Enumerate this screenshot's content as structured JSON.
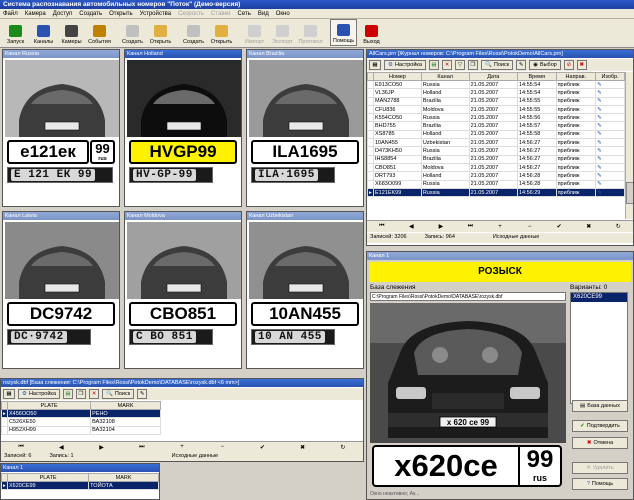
{
  "window_title": "Система распознавания автомобильных номеров \"Поток\" (Демо-версия)",
  "menu": [
    {
      "label": "Файл",
      "enabled": true
    },
    {
      "label": "Камера",
      "enabled": true
    },
    {
      "label": "Доступ",
      "enabled": true
    },
    {
      "label": "Создать",
      "enabled": true
    },
    {
      "label": "Открыть",
      "enabled": true
    },
    {
      "label": "Устройства",
      "enabled": true
    },
    {
      "label": "Скорость",
      "enabled": false
    },
    {
      "label": "Ставки",
      "enabled": false
    },
    {
      "label": "Сеть",
      "enabled": true
    },
    {
      "label": "Вид",
      "enabled": true
    },
    {
      "label": "Окно",
      "enabled": true
    }
  ],
  "toolbar": [
    {
      "label": "Запуск",
      "icon": "play-icon",
      "enabled": true
    },
    {
      "label": "Каналы",
      "icon": "channels-icon",
      "enabled": true
    },
    {
      "label": "Камеры",
      "icon": "camera-icon",
      "enabled": true
    },
    {
      "label": "События",
      "icon": "events-icon",
      "enabled": true
    },
    {
      "label": "Создать",
      "icon": "new-icon",
      "enabled": true
    },
    {
      "label": "Открыть",
      "icon": "open-icon",
      "enabled": true
    },
    {
      "label": "Создать",
      "icon": "new-icon",
      "enabled": true
    },
    {
      "label": "Открыть",
      "icon": "open-icon",
      "enabled": true
    },
    {
      "label": "Импорт",
      "icon": "import-icon",
      "enabled": false
    },
    {
      "label": "Экспорт",
      "icon": "export-icon",
      "enabled": false
    },
    {
      "label": "Протокол",
      "icon": "protocol-icon",
      "enabled": false
    },
    {
      "label": "Помощь",
      "icon": "help-icon",
      "enabled": true
    },
    {
      "label": "Выход",
      "icon": "exit-icon",
      "enabled": true
    }
  ],
  "cameras": [
    {
      "title": "Канал Russia",
      "plate": "e121ек",
      "region": "99",
      "region_sub": "rus",
      "plate_image": "Е 121 ЕК 99",
      "highlight": false
    },
    {
      "title": "Канал Holland",
      "plate": "HVGP99",
      "region": "",
      "region_sub": "",
      "plate_image": "HV-GP-99",
      "highlight": true
    },
    {
      "title": "Канал Brazilia",
      "plate": "ILA1695",
      "region": "",
      "region_sub": "",
      "plate_image": "ILA·1695",
      "highlight": false
    },
    {
      "title": "Канал Latvia",
      "plate": "DC9742",
      "region": "",
      "region_sub": "",
      "plate_image": "DC·9742",
      "highlight": false
    },
    {
      "title": "Канал Moldova",
      "plate": "CBO851",
      "region": "",
      "region_sub": "",
      "plate_image": "C BO 851",
      "highlight": false
    },
    {
      "title": "Канал Uzbekistan",
      "plate": "10AN455",
      "region": "",
      "region_sub": "",
      "plate_image": "10 AN 455",
      "highlight": false
    }
  ],
  "journal": {
    "title": "AllCars.prn [Журнал номеров: C:\\Program Files\\Rossi\\PotokDemo\\AllCars.prn]",
    "toolbar": {
      "settings": "Настройка",
      "search": "Поиск",
      "select": "Выбор"
    },
    "columns": [
      "Номер",
      "Канал",
      "Дата",
      "Время",
      "Направ.",
      "Изобр."
    ],
    "rows": [
      [
        "E913CO50",
        "Russia",
        "21.05.2007",
        "14:55:54",
        "приближ",
        ""
      ],
      [
        "VL36JP",
        "Holland",
        "21.05.2007",
        "14:55:54",
        "приближ",
        ""
      ],
      [
        "MAN2788",
        "Brazilia",
        "21.05.2007",
        "14:55:55",
        "приближ",
        ""
      ],
      [
        "CFU836",
        "Moldova",
        "21.05.2007",
        "14:55:55",
        "приближ",
        ""
      ],
      [
        "K554CO50",
        "Russia",
        "21.05.2007",
        "14:55:56",
        "приближ",
        ""
      ],
      [
        "BHD755",
        "Brazilia",
        "21.05.2007",
        "14:55:57",
        "приближ",
        ""
      ],
      [
        "XS8785",
        "Holland",
        "21.05.2007",
        "14:55:58",
        "приближ",
        ""
      ],
      [
        "10AN455",
        "Uzbekistan",
        "21.05.2007",
        "14:56:27",
        "приближ",
        ""
      ],
      [
        "D473KH50",
        "Russia",
        "21.05.2007",
        "14:56:27",
        "приближ",
        ""
      ],
      [
        "IHS8854",
        "Brazilia",
        "21.05.2007",
        "14:56:27",
        "приближ",
        ""
      ],
      [
        "CBO851",
        "Moldova",
        "21.05.2007",
        "14:56:27",
        "приближ",
        ""
      ],
      [
        "DRT793",
        "Holland",
        "21.05.2007",
        "14:56:28",
        "приближ",
        ""
      ],
      [
        "X683O099",
        "Russia",
        "21.05.2007",
        "14:56:28",
        "приближ",
        ""
      ],
      [
        "E121EK99",
        "Russia",
        "21.05.2007",
        "14:56:29",
        "приближ",
        ""
      ]
    ],
    "selected_row": 13,
    "status": {
      "records": "Записей: 3206",
      "record": "Запись: 964",
      "source": "Исходные данные"
    }
  },
  "wanted": {
    "title": "rozysk.dbf [База слежения: C:\\Program Files\\Rossi\\PotokDemo\\DATABASE\\rozysk.dbf <6 mm>]",
    "toolbar": {
      "settings": "Настройка",
      "search": "Поиск"
    },
    "columns": [
      "PLATE",
      "MARK"
    ],
    "rows": [
      [
        "X456OO50",
        "РЕНО"
      ],
      [
        "C526XE50",
        "ВАЗ2108"
      ],
      [
        "H952XH99",
        "ВАЗ2104"
      ]
    ],
    "selected_row": 0,
    "status": {
      "records": "Записей: 6",
      "record": "Запись: 1",
      "source": "Исходные данные"
    }
  },
  "channel1": {
    "title": "Канал 1",
    "columns": [
      "PLATE",
      "MARK"
    ],
    "rows": [
      [
        "X620CE99",
        "ТОЙОТА"
      ]
    ]
  },
  "alert": {
    "title": "Канал 1",
    "banner": "РОЗЫСК",
    "db_label": "База слежения",
    "db_path": "C:\\Program Files\\Rossi\\PotokDemo\\DATABASE\\rozysk.dbf",
    "variants_label": "Варианты: 0",
    "variant_selected": "X620CE99",
    "plate": "x620ce",
    "region": "99",
    "region_sub": "rus",
    "photo_plate": "x 620 ce 99",
    "buttons": {
      "db": "База данных",
      "confirm": "Подтвердить",
      "cancel": "Отмена",
      "delete": "Удалить",
      "help": "Помощь"
    }
  },
  "statusbar": "Окно неактивно; Ак..."
}
